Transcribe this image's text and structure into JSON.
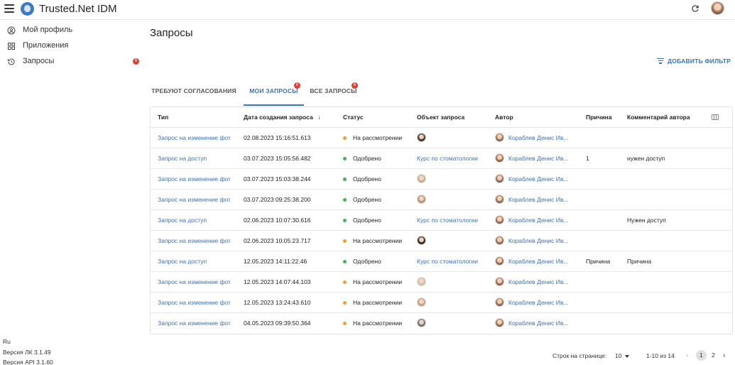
{
  "app": {
    "title": "Trusted.Net IDM"
  },
  "sidebar": {
    "items": [
      {
        "label": "Мой профиль",
        "icon": "account-circle-icon"
      },
      {
        "label": "Приложения",
        "icon": "apps-grid-icon"
      },
      {
        "label": "Запросы",
        "icon": "history-icon",
        "badge": "6"
      }
    ],
    "footer": {
      "lang": "Ru",
      "lk_version": "Версия ЛК 3.1.49",
      "api_version": "Версия API 3.1.60"
    }
  },
  "page": {
    "title": "Запросы",
    "add_filter": "ДОБАВИТЬ ФИЛЬТР"
  },
  "tabs": [
    {
      "label": "ТРЕБУЮТ СОГЛАСОВАНИЯ",
      "badge": ""
    },
    {
      "label": "МОИ ЗАПРОСЫ",
      "badge": "6"
    },
    {
      "label": "ВСЕ ЗАПРОСЫ",
      "badge": "6"
    }
  ],
  "table": {
    "headers": {
      "type": "Тип",
      "date": "Дата создания запроса",
      "sort_arrow": "↓",
      "status": "Статус",
      "object": "Объект запроса",
      "author": "Автор",
      "reason": "Причина",
      "comment": "Комментарий автора"
    },
    "rows": [
      {
        "type": "Запрос на изменение фот",
        "date": "02.08.2023 15:16:51.613",
        "status": "На рассмотрении",
        "status_color": "#f59c34",
        "object": "",
        "object_avatar": "#3b2a22",
        "author": "Кораблев Денис Ив...",
        "reason": "",
        "comment": ""
      },
      {
        "type": "Запрос на доступ",
        "date": "03.07.2023 15:05:56.482",
        "status": "Одобрено",
        "status_color": "#43b552",
        "object": "Курс по стоматологии",
        "object_avatar": "",
        "author": "Кораблев Денис Ив...",
        "reason": "1",
        "comment": "нужен доступ"
      },
      {
        "type": "Запрос на изменение фот",
        "date": "03.07.2023 15:03:38.244",
        "status": "Одобрено",
        "status_color": "#43b552",
        "object": "",
        "object_avatar": "#c9a78d",
        "author": "Кораблев Денис Ив...",
        "reason": "",
        "comment": ""
      },
      {
        "type": "Запрос на изменение фот",
        "date": "03.07.2023 09:25:38.200",
        "status": "Одобрено",
        "status_color": "#43b552",
        "object": "",
        "object_avatar": "#b98d73",
        "author": "Кораблев Денис Ив...",
        "reason": "",
        "comment": ""
      },
      {
        "type": "Запрос на доступ",
        "date": "02.06.2023 10:07:30.616",
        "status": "Одобрено",
        "status_color": "#43b552",
        "object": "Курс по стоматологии",
        "object_avatar": "",
        "author": "Кораблев Денис Ив...",
        "reason": "",
        "comment": "Нужен доступ"
      },
      {
        "type": "Запрос на изменение фот",
        "date": "02.06.2023 10:05:23.717",
        "status": "На рассмотрении",
        "status_color": "#f59c34",
        "object": "",
        "object_avatar": "#2e221c",
        "author": "Кораблев Денис Ив...",
        "reason": "",
        "comment": ""
      },
      {
        "type": "Запрос на доступ",
        "date": "12.05.2023 14:11:22.46",
        "status": "Одобрено",
        "status_color": "#43b552",
        "object": "Курс по стоматологии",
        "object_avatar": "",
        "author": "Кораблев Денис Ив...",
        "reason": "Причина",
        "comment": "Причина"
      },
      {
        "type": "Запрос на изменение фот",
        "date": "12.05.2023 14:07:44.103",
        "status": "На рассмотрении",
        "status_color": "#f59c34",
        "object": "",
        "object_avatar": "#d7bba2",
        "author": "Кораблев Денис Ив...",
        "reason": "",
        "comment": ""
      },
      {
        "type": "Запрос на изменение фот",
        "date": "12.05.2023 13:24:43.610",
        "status": "На рассмотрении",
        "status_color": "#f59c34",
        "object": "",
        "object_avatar": "#c49a80",
        "author": "Кораблев Денис Ив...",
        "reason": "",
        "comment": ""
      },
      {
        "type": "Запрос на изменение фот",
        "date": "04.05.2023 09:39:50.364",
        "status": "На рассмотрении",
        "status_color": "#f59c34",
        "object": "",
        "object_avatar": "#6d6d6d",
        "author": "Кораблев Денис Ив...",
        "reason": "",
        "comment": ""
      }
    ]
  },
  "pagination": {
    "rows_per_page_label": "Строк на странице:",
    "rows_per_page": "10",
    "range": "1-10 из 14",
    "prev": "‹",
    "next": "›",
    "pages": [
      "1",
      "2"
    ]
  },
  "colors": {
    "accent": "#3b72b9",
    "badge": "#e53935",
    "pending": "#f59c34",
    "approved": "#43b552"
  }
}
